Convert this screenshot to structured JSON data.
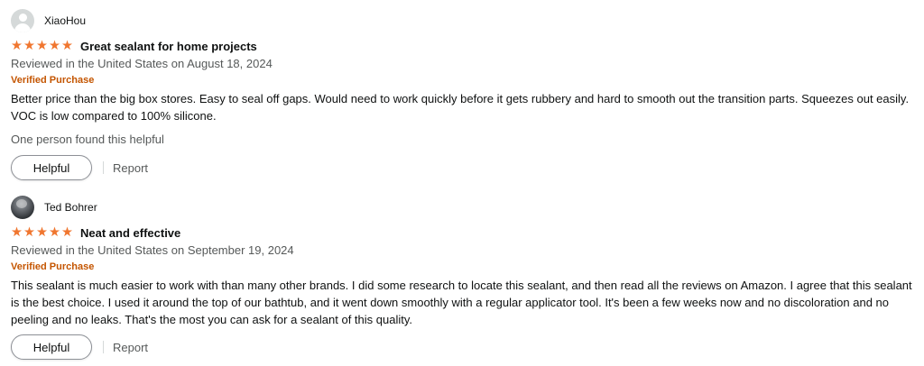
{
  "reviews": [
    {
      "profile_name": "XiaoHou",
      "avatar_icon": "default-profile-icon",
      "rating": 5,
      "title": "Great sealant for home projects",
      "meta": "Reviewed in the United States on August 18, 2024",
      "verified": "Verified Purchase",
      "body": "Better price than the big box stores. Easy to seal off gaps. Would need to work quickly before it gets rubbery and hard to smooth out the transition parts. Squeezes out easily. VOC is low compared to 100% silicone.",
      "helpful_count": "One person found this helpful",
      "helpful_label": "Helpful",
      "report_label": "Report"
    },
    {
      "profile_name": "Ted Bohrer",
      "avatar_icon": "profile-photo",
      "rating": 5,
      "title": "Neat and effective",
      "meta": "Reviewed in the United States on September 19, 2024",
      "verified": "Verified Purchase",
      "body": "This sealant is much easier to work with than many other brands. I did some research to locate this sealant, and then read all the reviews on Amazon. I agree that this sealant is the best choice. I used it around the top of our bathtub, and it went down smoothly with a regular applicator tool. It's been a few weeks now and no discoloration and no peeling and no leaks. That's the most you can ask for a sealant of this quality.",
      "helpful_label": "Helpful",
      "report_label": "Report"
    }
  ],
  "colors": {
    "star": "#f0762f",
    "verified": "#c45500",
    "meta": "#565959",
    "text": "#0f1111"
  }
}
